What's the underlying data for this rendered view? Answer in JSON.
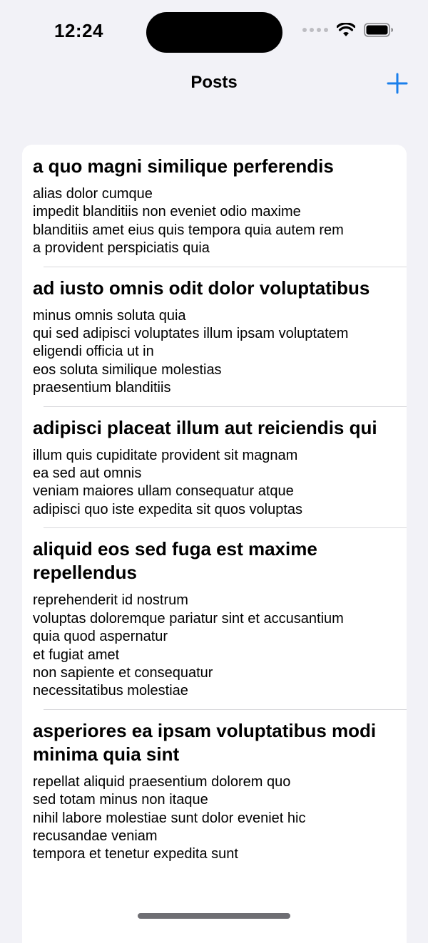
{
  "status_bar": {
    "time": "12:24"
  },
  "nav": {
    "title": "Posts",
    "add_icon": "plus-icon",
    "accent": "#1A7FEB"
  },
  "posts": [
    {
      "title": "a quo magni similique perferendis",
      "body": "alias dolor cumque\nimpedit blanditiis non eveniet odio maxime\nblanditiis amet eius quis tempora quia autem rem\na provident perspiciatis quia"
    },
    {
      "title": "ad iusto omnis odit dolor voluptatibus",
      "body": "minus omnis soluta quia\nqui sed adipisci voluptates illum ipsam voluptatem\neligendi officia ut in\neos soluta similique molestias\npraesentium blanditiis"
    },
    {
      "title": "adipisci placeat illum aut reiciendis qui",
      "body": "illum quis cupiditate provident sit magnam\nea sed aut omnis\nveniam maiores ullam consequatur atque\nadipisci quo iste expedita sit quos voluptas"
    },
    {
      "title": "aliquid eos sed fuga est maxime repellendus",
      "body": "reprehenderit id nostrum\nvoluptas doloremque pariatur sint et accusantium\nquia quod aspernatur\net fugiat amet\nnon sapiente et consequatur\nnecessitatibus molestiae"
    },
    {
      "title": "asperiores ea ipsam voluptatibus modi minima quia sint",
      "body": "repellat aliquid praesentium dolorem quo\nsed totam minus non itaque\nnihil labore molestiae sunt dolor eveniet hic\nrecusandae veniam\ntempora et tenetur expedita sunt"
    }
  ]
}
